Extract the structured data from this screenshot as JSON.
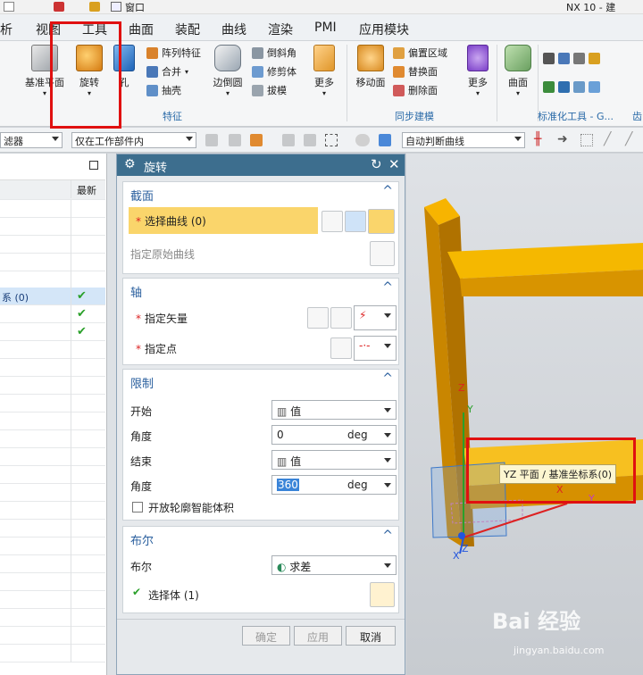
{
  "window": {
    "title": "NX 10 - 建"
  },
  "quickaccess": {
    "window_menu": "窗口"
  },
  "menubar": {
    "items": [
      "析",
      "视图",
      "工具",
      "曲面",
      "装配",
      "曲线",
      "渲染",
      "PMI",
      "应用模块"
    ]
  },
  "ribbon": {
    "datum_plane": "基准平面",
    "revolve": "旋转",
    "hole": "孔",
    "pattern_feature": "阵列特征",
    "unite": "合并",
    "shell": "抽壳",
    "edge_blend": "边倒圆",
    "chamfer": "倒斜角",
    "trim_body": "修剪体",
    "draft": "拔模",
    "more1": "更多",
    "move_face": "移动面",
    "offset_region": "偏置区域",
    "replace_face": "替换面",
    "delete_face": "删除面",
    "more2": "更多",
    "surface": "曲面",
    "group_feature": "特征",
    "group_sync": "同步建模",
    "group_std": "标准化工具 - G...",
    "group_gear": "齿"
  },
  "toolbar2": {
    "filter": "滤器",
    "scope": "仅在工作部件内",
    "curve_rule": "自动判断曲线"
  },
  "navigator": {
    "header_latest": "最新",
    "row_label": "系 (0)"
  },
  "dialog": {
    "title": "旋转",
    "section": {
      "header": "截面",
      "select_curve": "选择曲线 (0)",
      "specify_origin_curve": "指定原始曲线"
    },
    "axis": {
      "header": "轴",
      "specify_vector": "指定矢量",
      "specify_point": "指定点"
    },
    "limits": {
      "header": "限制",
      "start_label": "开始",
      "start_mode": "值",
      "angle_label": "角度",
      "start_angle": "0",
      "unit1": "deg",
      "end_label": "结束",
      "end_mode": "值",
      "angle_label2": "角度",
      "end_angle": "360",
      "unit2": "deg",
      "open_profile": "开放轮廓智能体积"
    },
    "boolean": {
      "header": "布尔",
      "label": "布尔",
      "value": "求差",
      "select_body": "选择体 (1)"
    },
    "buttons": {
      "ok": "确定",
      "apply": "应用",
      "cancel": "取消"
    }
  },
  "viewport": {
    "tooltip": "YZ 平面 / 基准坐标系(0)",
    "axis_y": "Y",
    "axis_z": "Z",
    "axis_x": "X",
    "axis_z2": "Z",
    "axis_x2": "X",
    "axis_x3": "Y"
  },
  "watermark": {
    "text": "Bai 经验",
    "url": "jingyan.baidu.com"
  },
  "colors": {
    "accent": "#3d6e8e",
    "highlight": "#fad56b",
    "beam": "#f5a800",
    "annotation": "#e01010"
  }
}
